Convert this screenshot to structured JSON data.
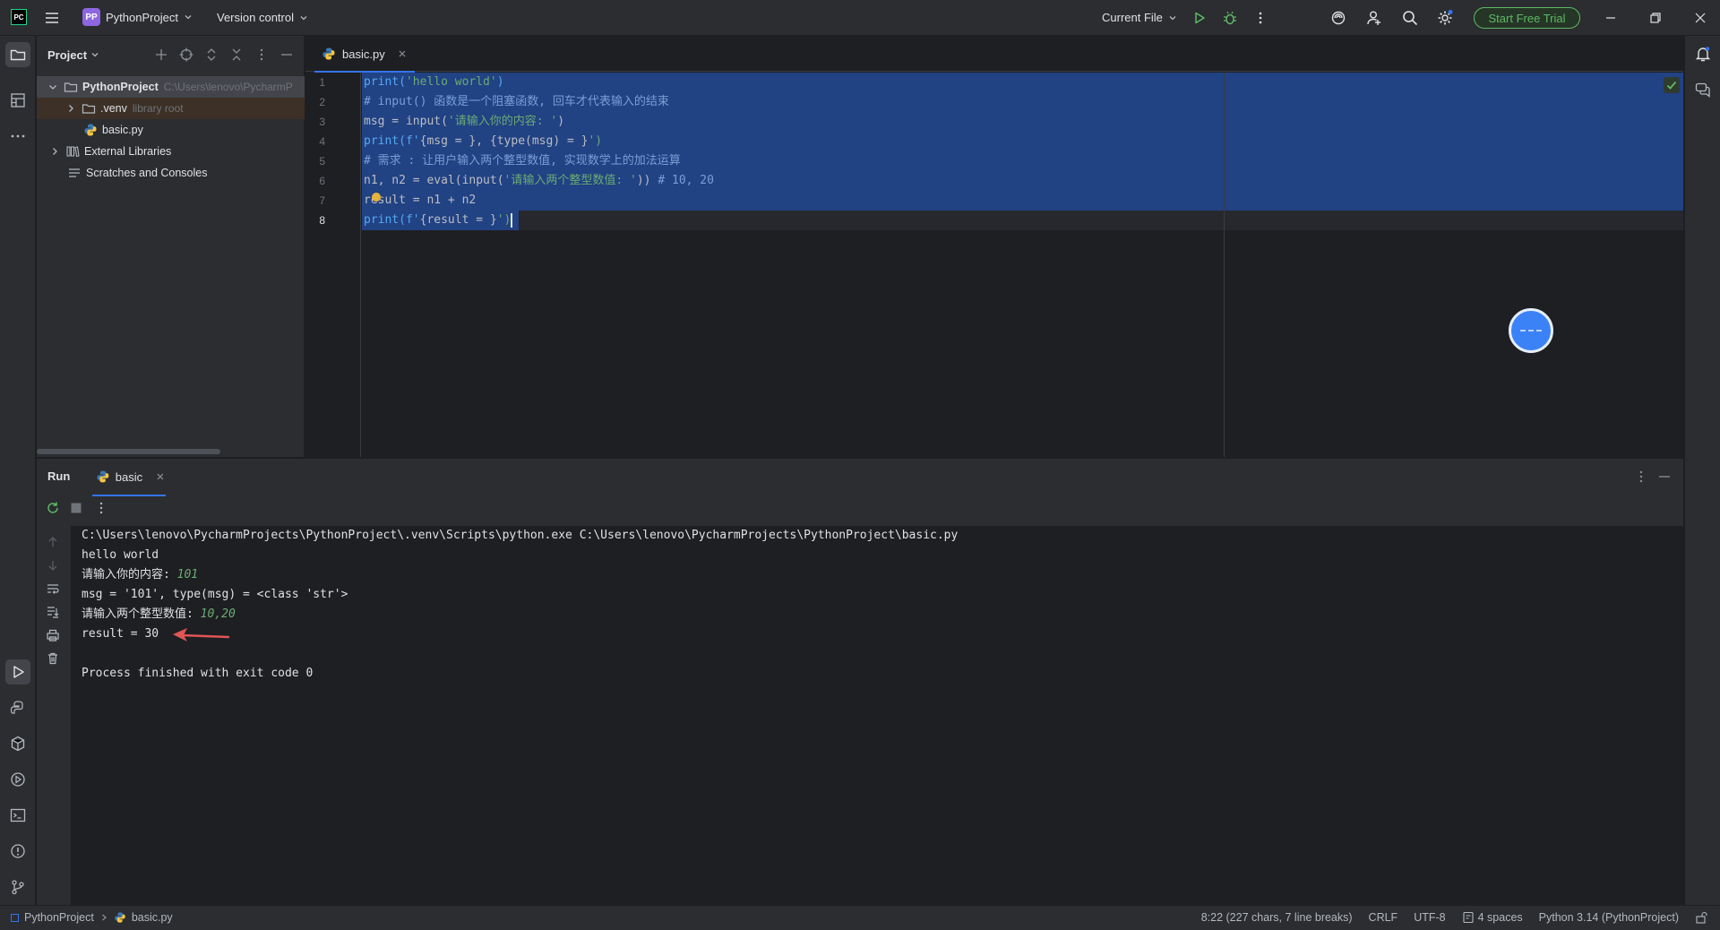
{
  "titlebar": {
    "logo": "PC",
    "project_badge": "PP",
    "project_name": "PythonProject",
    "version_control": "Version control",
    "run_config": "Current File",
    "trial_button": "Start Free Trial"
  },
  "project_panel": {
    "title": "Project",
    "tree": [
      {
        "label": "PythonProject",
        "hint": "C:\\Users\\lenovo\\PycharmP"
      },
      {
        "label": ".venv",
        "hint": "library root"
      },
      {
        "label": "basic.py",
        "hint": ""
      },
      {
        "label": "External Libraries",
        "hint": ""
      },
      {
        "label": "Scratches and Consoles",
        "hint": ""
      }
    ]
  },
  "editor": {
    "tab_label": "basic.py",
    "line_numbers": [
      "1",
      "2",
      "3",
      "4",
      "5",
      "6",
      "7",
      "8"
    ],
    "code": [
      {
        "a": "print(",
        "b": "'hello world'",
        "c": ")",
        "d": ""
      },
      {
        "a": "# input() 函数是一个阻塞函数, 回车才代表输入的结束",
        "b": "",
        "c": "",
        "d": ""
      },
      {
        "a": "msg = input(",
        "b": "'请输入你的内容: '",
        "c": ")",
        "d": ""
      },
      {
        "a": "print(f'",
        "b": "{msg = }, {type(msg) = }",
        "c": "')",
        "d": ""
      },
      {
        "a": "# 需求 : 让用户输入两个整型数值, 实现数学上的加法运算",
        "b": "",
        "c": "",
        "d": ""
      },
      {
        "a": "n1, n2 = eval(input(",
        "b": "'请输入两个整型数值: '",
        "c": "))",
        "d": " # 10, 20"
      },
      {
        "a": "result = n1 + n2",
        "b": "",
        "c": "",
        "d": ""
      },
      {
        "a": "print(f'",
        "b": "{result = }",
        "c": "')",
        "d": ""
      }
    ]
  },
  "run_panel": {
    "title": "Run",
    "tab_label": "basic",
    "console": [
      {
        "text": "C:\\Users\\lenovo\\PycharmProjects\\PythonProject\\.venv\\Scripts\\python.exe C:\\Users\\lenovo\\PycharmProjects\\PythonProject\\basic.py",
        "input": ""
      },
      {
        "text": "hello world",
        "input": ""
      },
      {
        "text": "请输入你的内容: ",
        "input": "101"
      },
      {
        "text": "msg = '101', type(msg) = <class 'str'>",
        "input": ""
      },
      {
        "text": "请输入两个整型数值: ",
        "input": "10,20"
      },
      {
        "text": "result = 30",
        "input": ""
      },
      {
        "text": "",
        "input": ""
      },
      {
        "text": "Process finished with exit code 0",
        "input": ""
      }
    ]
  },
  "statusbar": {
    "breadcrumb_project": "PythonProject",
    "breadcrumb_file": "basic.py",
    "position": "8:22 (227 chars, 7 line breaks)",
    "line_ending": "CRLF",
    "encoding": "UTF-8",
    "indent": "4 spaces",
    "interpreter": "Python 3.14 (PythonProject)"
  },
  "colors": {
    "accent": "#3574f0",
    "selection": "#214283",
    "trial_green": "#5fb865",
    "string_green": "#6aab73",
    "comment_gray": "#7a7e85",
    "annotation_red": "#e05555"
  }
}
